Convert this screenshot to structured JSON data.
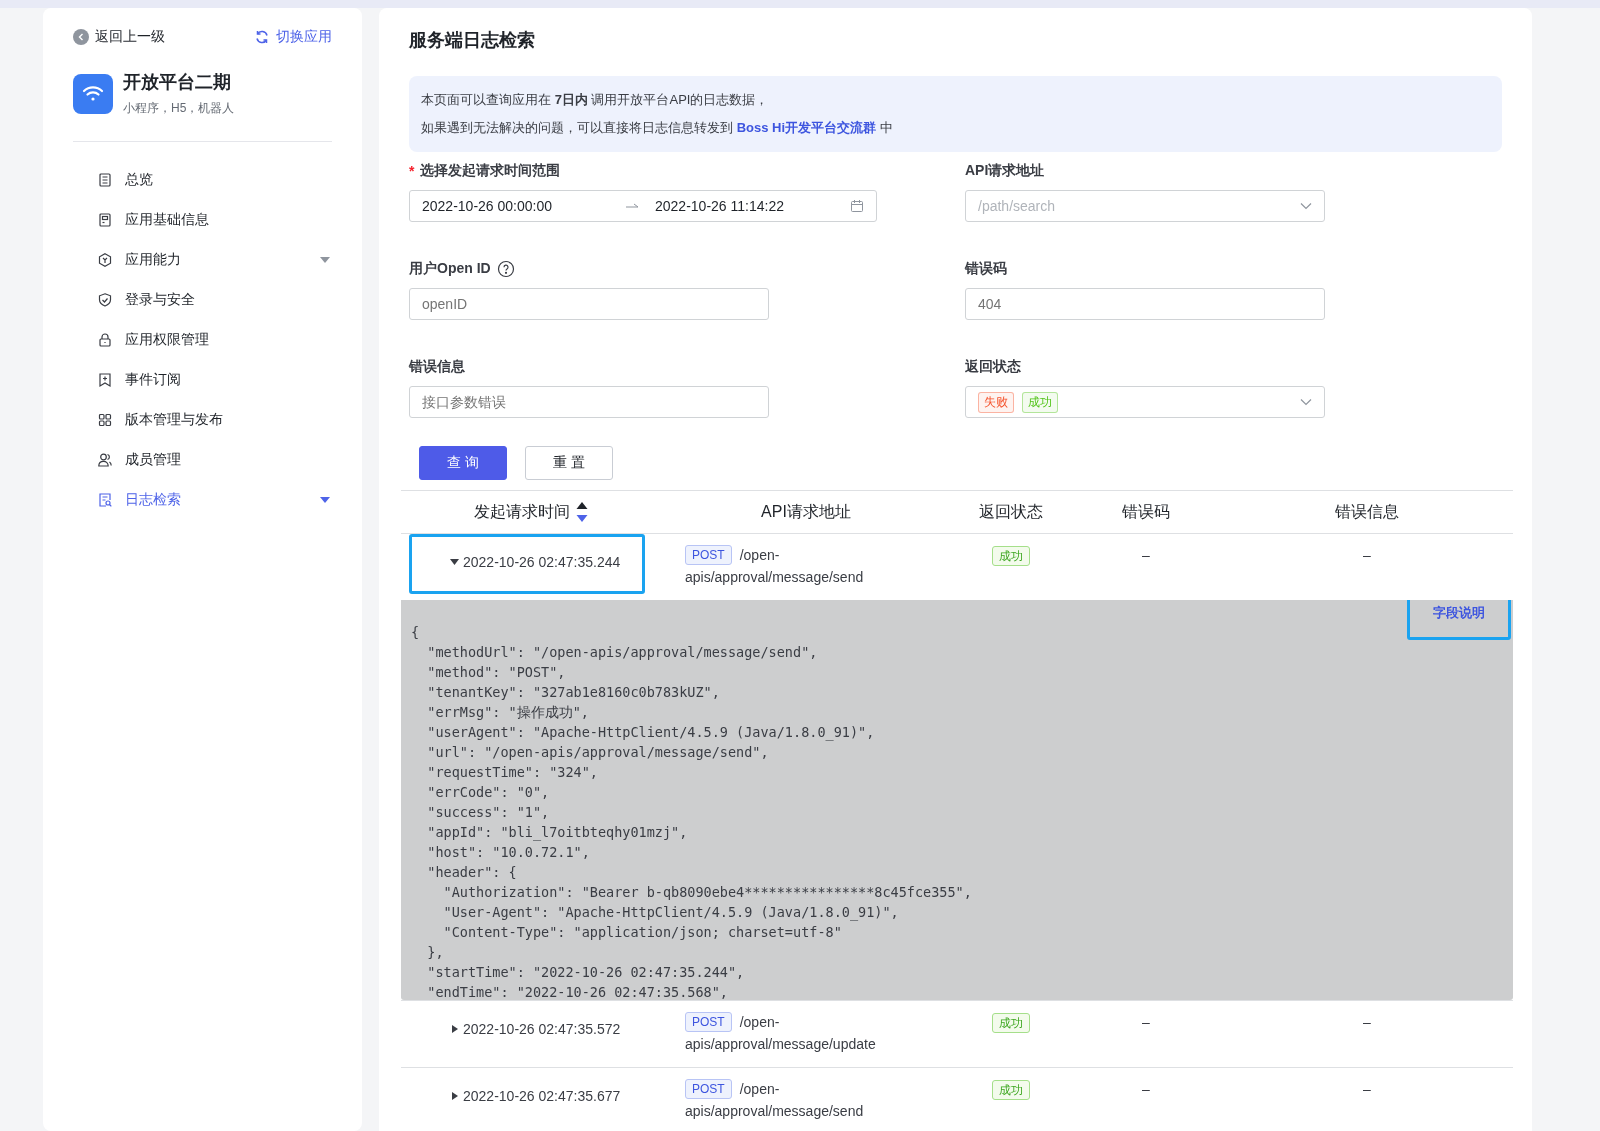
{
  "sidebar": {
    "back_link": "返回上一级",
    "switch_link": "切换应用",
    "app": {
      "name": "开放平台二期",
      "subtitle": "小程序，H5，机器人"
    },
    "nav": [
      {
        "label": "总览",
        "selected": false,
        "expandable": false
      },
      {
        "label": "应用基础信息",
        "selected": false,
        "expandable": false
      },
      {
        "label": "应用能力",
        "selected": false,
        "expandable": true
      },
      {
        "label": "登录与安全",
        "selected": false,
        "expandable": false
      },
      {
        "label": "应用权限管理",
        "selected": false,
        "expandable": false
      },
      {
        "label": "事件订阅",
        "selected": false,
        "expandable": false
      },
      {
        "label": "版本管理与发布",
        "selected": false,
        "expandable": false
      },
      {
        "label": "成员管理",
        "selected": false,
        "expandable": false
      },
      {
        "label": "日志检索",
        "selected": true,
        "expandable": true
      }
    ]
  },
  "main": {
    "title": "服务端日志检索",
    "notice": {
      "line_1": "本页面可以查询应用在 **7日内** 调用开放平台API的日志数据，",
      "line_2": "如果遇到无法解决的问题，可以直接将日志信息转发到",
      "link": "Boss Hi开发平台交流群",
      "line_2_end": "中"
    },
    "form": [
      {
        "kind": "daterange",
        "required_mark": "*",
        "label": "选择发起请求时间范围",
        "start": "2022-10-26 00:00:00",
        "end": "2022-10-26 11:14:22"
      },
      {
        "kind": "select",
        "label": "API请求地址",
        "placeholder": "/path/search"
      },
      {
        "kind": "input",
        "label": "用户Open ID",
        "help": true,
        "placeholder": "openID"
      },
      {
        "kind": "input",
        "label": "错误码",
        "placeholder": "404"
      },
      {
        "kind": "input",
        "label": "错误信息",
        "placeholder": "接口参数错误"
      },
      {
        "kind": "tags",
        "label": "返回状态",
        "tags": [
          {
            "label": "失败",
            "color": "#f5532d"
          },
          {
            "label": "成功",
            "color": "#52c41a"
          }
        ]
      }
    ],
    "buttons": [
      {
        "label": "查 询",
        "kind": "primary"
      },
      {
        "label": "重 置",
        "kind": "default"
      }
    ],
    "table": {
      "columns": [
        {
          "label": "发起请求时间",
          "sort_descending": true
        },
        {
          "label": "API请求地址"
        },
        {
          "label": "返回状态"
        },
        {
          "label": "错误码"
        },
        {
          "label": "错误信息"
        }
      ],
      "rows": [
        {
          "time": "2022-10-26 02:47:35.244",
          "expanded": true,
          "highlighted": true,
          "method": "POST",
          "path": "/open-apis/approval/message/send",
          "status": "成功",
          "error_code": "–",
          "error_message": "–",
          "detail": {
            "link": "字段说明",
            "link_highlighted": true,
            "code_lines": [
              "{",
              "  \"methodUrl\": \"/open-apis/approval/message/send\",",
              "  \"method\": \"POST\",",
              "  \"tenantKey\": \"327ab1e8160c0b783kUZ\",",
              "  \"errMsg\": \"操作成功\",",
              "  \"userAgent\": \"Apache-HttpClient/4.5.9 (Java/1.8.0_91)\",",
              "  \"url\": \"/open-apis/approval/message/send\",",
              "  \"requestTime\": \"324\",",
              "  \"errCode\": \"0\",",
              "  \"success\": \"1\",",
              "  \"appId\": \"bli_l7oitbteqhy01mzj\",",
              "  \"host\": \"10.0.72.1\",",
              "  \"header\": {",
              "    \"Authorization\": \"Bearer b-qb8090ebe4****************8c45fce355\",",
              "    \"User-Agent\": \"Apache-HttpClient/4.5.9 (Java/1.8.0_91)\",",
              "    \"Content-Type\": \"application/json; charset=utf-8\"",
              "  },",
              "  \"startTime\": \"2022-10-26 02:47:35.244\",",
              "  \"endTime\": \"2022-10-26 02:47:35.568\","
            ]
          }
        },
        {
          "time": "2022-10-26 02:47:35.572",
          "expanded": false,
          "highlighted": false,
          "method": "POST",
          "path": "/open-apis/approval/message/update",
          "status": "成功",
          "error_code": "–",
          "error_message": "–"
        },
        {
          "time": "2022-10-26 02:47:35.677",
          "expanded": false,
          "highlighted": false,
          "method": "POST",
          "path": "/open-apis/approval/message/send",
          "status": "成功",
          "error_code": "–",
          "error_message": "–"
        }
      ]
    }
  }
}
